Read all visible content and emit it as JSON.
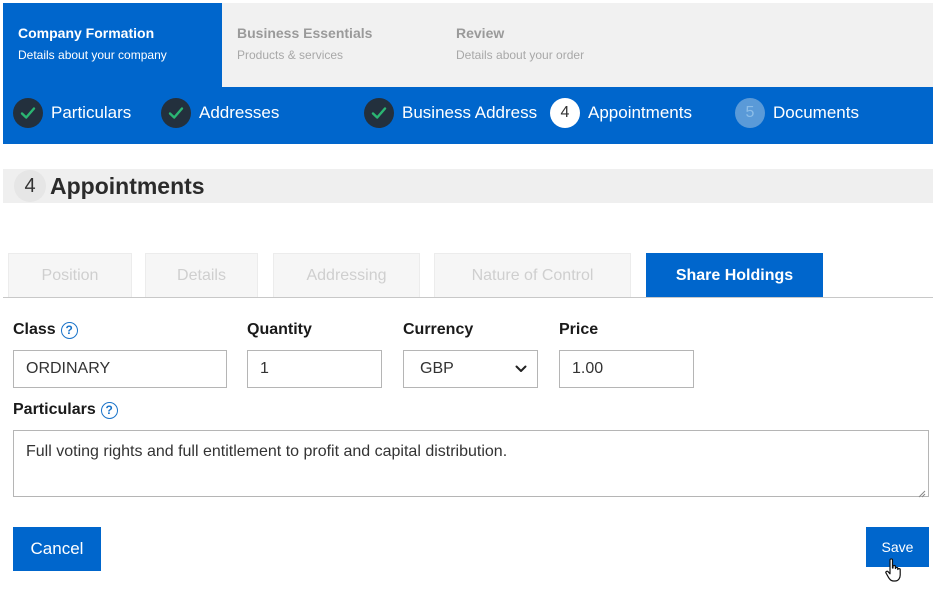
{
  "stages": [
    {
      "title": "Company Formation",
      "subtitle": "Details about your company"
    },
    {
      "title": "Business Essentials",
      "subtitle": "Products & services"
    },
    {
      "title": "Review",
      "subtitle": "Details about your order"
    }
  ],
  "steps": [
    {
      "label": "Particulars",
      "state": "done",
      "number": ""
    },
    {
      "label": "Addresses",
      "state": "done",
      "number": ""
    },
    {
      "label": "Business Address",
      "state": "done",
      "number": ""
    },
    {
      "label": "Appointments",
      "state": "current",
      "number": "4"
    },
    {
      "label": "Documents",
      "state": "pending",
      "number": "5"
    }
  ],
  "section": {
    "number": "4",
    "title": "Appointments"
  },
  "tabs": [
    {
      "label": "Position",
      "active": false
    },
    {
      "label": "Details",
      "active": false
    },
    {
      "label": "Addressing",
      "active": false
    },
    {
      "label": "Nature of Control",
      "active": false
    },
    {
      "label": "Share Holdings",
      "active": true
    }
  ],
  "form": {
    "class_label": "Class",
    "class_value": "ORDINARY",
    "quantity_label": "Quantity",
    "quantity_value": "1",
    "currency_label": "Currency",
    "currency_value": "GBP",
    "price_label": "Price",
    "price_value": "1.00",
    "particulars_label": "Particulars",
    "particulars_value": "Full voting rights and full entitlement to profit and capital distribution.",
    "help_glyph": "?"
  },
  "actions": {
    "cancel_label": "Cancel",
    "save_label": "Save"
  },
  "colors": {
    "primary": "#0066cc",
    "done_circle": "#23303d",
    "check": "#2bb673",
    "pending_circle": "#5a9ad8"
  }
}
